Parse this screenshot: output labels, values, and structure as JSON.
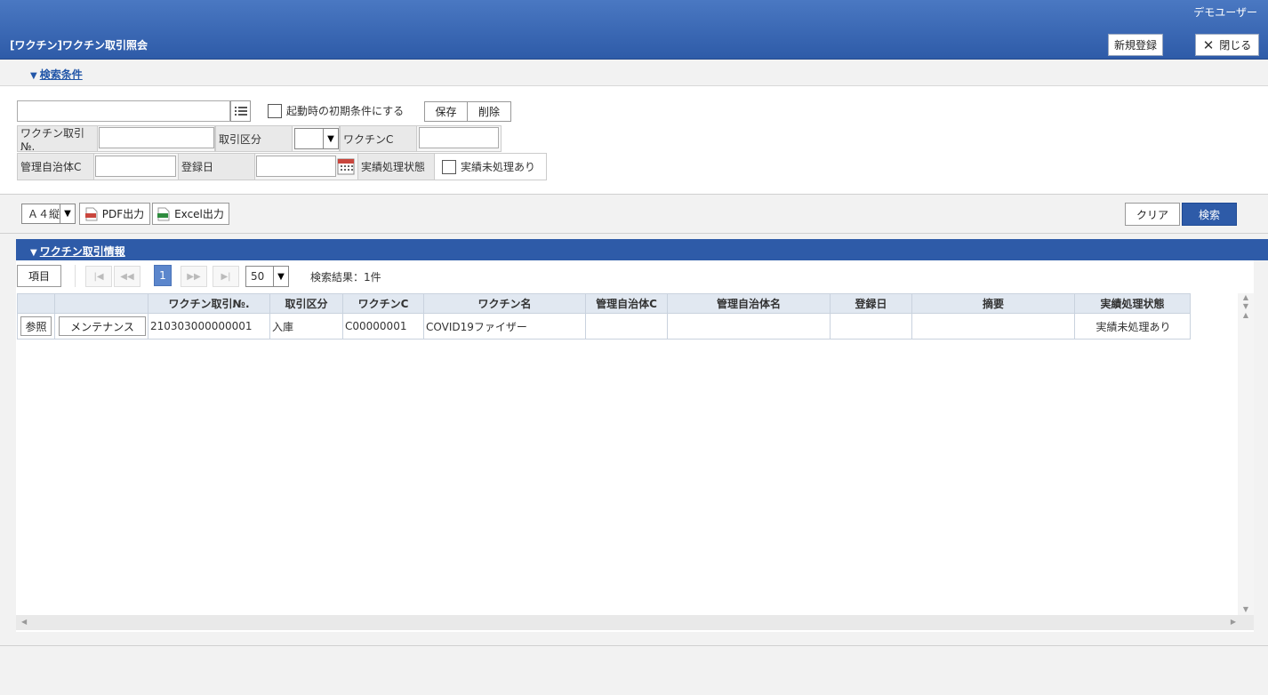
{
  "header": {
    "user": "デモユーザー",
    "title": "[ワクチン]ワクチン取引照会",
    "new_button": "新規登録",
    "close_button": "閉じる"
  },
  "search": {
    "section_title": "検索条件",
    "preset_checkbox_label": "起動時の初期条件にする",
    "save_button": "保存",
    "delete_button": "削除",
    "fields": {
      "trade_no_label": "ワクチン取引№.",
      "trade_type_label": "取引区分",
      "vaccine_c_label": "ワクチンC",
      "municipality_c_label": "管理自治体C",
      "reg_date_label": "登録日",
      "status_label": "実績処理状態",
      "status_checkbox_label": "実績未処理あり"
    }
  },
  "toolbar": {
    "paper_size": "Ａ４縦",
    "pdf_button": "PDF出力",
    "excel_button": "Excel出力",
    "clear_button": "クリア",
    "search_button": "検索"
  },
  "results": {
    "section_title": "ワクチン取引情報",
    "columns_button": "項目",
    "current_page": "1",
    "page_size": "50",
    "result_count": "検索結果：1件",
    "headers": [
      "",
      "",
      "ワクチン取引№.",
      "取引区分",
      "ワクチンC",
      "ワクチン名",
      "管理自治体C",
      "管理自治体名",
      "登録日",
      "摘要",
      "実績処理状態"
    ],
    "rows": [
      {
        "view_button": "参照",
        "maint_button": "メンテナンス",
        "trade_no": "210303000000001",
        "trade_type": "入庫",
        "vaccine_c": "C00000001",
        "vaccine_name": "COVID19ファイザー",
        "municipality_c": "",
        "municipality_name": "",
        "reg_date": "",
        "summary": "",
        "status": "実績未処理あり"
      }
    ]
  }
}
